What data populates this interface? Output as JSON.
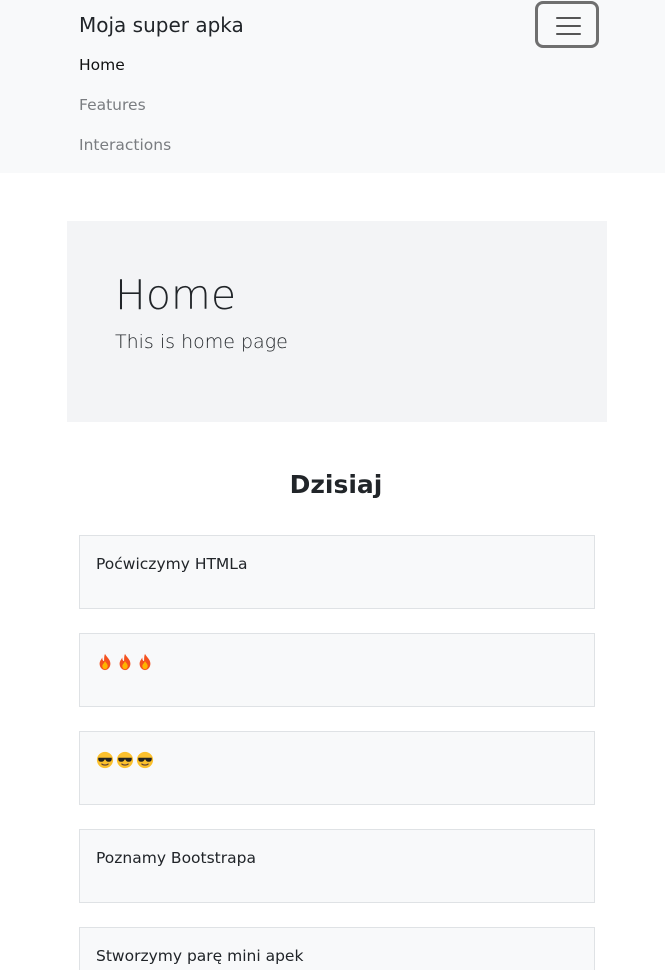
{
  "navbar": {
    "brand": "Moja super apka",
    "links": [
      {
        "label": "Home",
        "active": true
      },
      {
        "label": "Features",
        "active": false
      },
      {
        "label": "Interactions",
        "active": false
      }
    ],
    "toggler_icon": "hamburger-menu-icon"
  },
  "jumbotron": {
    "title": "Home",
    "lead": "This is home page"
  },
  "section": {
    "title": "Dzisiaj",
    "cards": [
      {
        "type": "text",
        "text": "Poćwiczymy HTMLa"
      },
      {
        "type": "emoji",
        "icon": "fire-emoji-icon",
        "count": 3
      },
      {
        "type": "emoji",
        "icon": "sunglasses-face-emoji-icon",
        "count": 3
      },
      {
        "type": "text",
        "text": "Poznamy Bootstrapa"
      },
      {
        "type": "text",
        "text": "Stworzymy parę mini apek"
      }
    ]
  },
  "colors": {
    "navbar_bg": "#f8f9fa",
    "jumbotron_bg": "#f3f4f6",
    "card_bg": "#f8f9fa",
    "card_border": "#dfe2e5",
    "text": "#212529",
    "nav_muted": "#7a7d81"
  }
}
